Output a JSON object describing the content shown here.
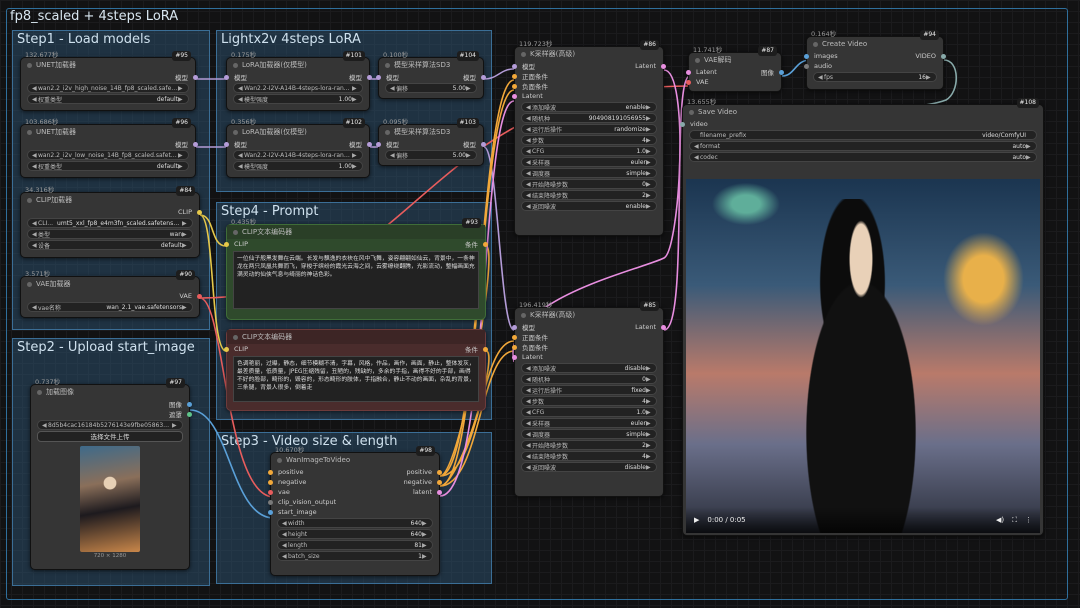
{
  "workflow_title": "fp8_scaled + 4steps LoRA",
  "groups": {
    "g1": "Step1 - Load models",
    "g2": "Lightx2v 4steps LoRA",
    "g3": "Step2 - Upload start_image",
    "g4": "Step4 - Prompt",
    "g5": "Step3 - Video size & length"
  },
  "unet1": {
    "time": "132.677秒",
    "badge": "#95",
    "title": "UNET加载器",
    "out": "模型",
    "model": "wan2.2_i2v_high_noise_14B_fp8_scaled.safet...",
    "dtype_label": "权重类型",
    "dtype": "default"
  },
  "unet2": {
    "time": "103.686秒",
    "badge": "#96",
    "title": "UNET加载器",
    "out": "模型",
    "model": "wan2.2_i2v_low_noise_14B_fp8_scaled.safete...",
    "dtype_label": "权重类型",
    "dtype": "default"
  },
  "clipl": {
    "time": "34.316秒",
    "badge": "#84",
    "title": "CLIP加载器",
    "out": "CLIP",
    "name_label": "CLI...",
    "name": "umt5_xxl_fp8_e4m3fn_scaled.safetensors",
    "type_label": "类型",
    "type": "wan",
    "device_label": "设备",
    "device": "default"
  },
  "vael": {
    "time": "3.571秒",
    "badge": "#90",
    "title": "VAE加载器",
    "out": "VAE",
    "name_label": "vae名称",
    "name": "wan_2.1_vae.safetensors"
  },
  "lora1": {
    "time": "0.175秒",
    "badge": "#101",
    "title": "LoRA加载器(仅模型)",
    "in": "模型",
    "out": "模型",
    "name": "Wan2.2-I2V-A14B-4steps-lora-ran...",
    "str_label": "模型强度",
    "str": "1.00"
  },
  "lora2": {
    "time": "0.356秒",
    "badge": "#102",
    "title": "LoRA加载器(仅模型)",
    "in": "模型",
    "out": "模型",
    "name": "Wan2.2-I2V-A14B-4steps-lora-rank...",
    "str_label": "模型强度",
    "str": "1.00"
  },
  "sd1": {
    "time": "0.100秒",
    "badge": "#104",
    "title": "模型采样算法SD3",
    "in": "模型",
    "out": "模型",
    "shift_label": "偏移",
    "shift": "5.00"
  },
  "sd2": {
    "time": "0.095秒",
    "badge": "#103",
    "title": "模型采样算法SD3",
    "in": "模型",
    "out": "模型",
    "shift_label": "偏移",
    "shift": "5.00"
  },
  "ks1": {
    "time": "119.723秒",
    "badge": "#86",
    "title": "K采样器(高级)",
    "inputs": [
      "模型",
      "正面条件",
      "负面条件",
      "Latent"
    ],
    "out": "Latent",
    "widgets": [
      [
        "添加噪波",
        "enable"
      ],
      [
        "随机种",
        "904908191056955"
      ],
      [
        "运行后操作",
        "randomize"
      ],
      [
        "步数",
        "4"
      ],
      [
        "CFG",
        "1.0"
      ],
      [
        "采样器",
        "euler"
      ],
      [
        "调度器",
        "simple"
      ],
      [
        "开始降噪步数",
        "0"
      ],
      [
        "结束降噪步数",
        "2"
      ],
      [
        "返回噪波",
        "enable"
      ]
    ]
  },
  "ks2": {
    "time": "196.419秒",
    "badge": "#85",
    "title": "K采样器(高级)",
    "inputs": [
      "模型",
      "正面条件",
      "负面条件",
      "Latent"
    ],
    "out": "Latent",
    "widgets": [
      [
        "添加噪波",
        "disable"
      ],
      [
        "随机种",
        "0"
      ],
      [
        "运行后操作",
        "fixed"
      ],
      [
        "步数",
        "4"
      ],
      [
        "CFG",
        "1.0"
      ],
      [
        "采样器",
        "euler"
      ],
      [
        "调度器",
        "simple"
      ],
      [
        "开始降噪步数",
        "2"
      ],
      [
        "结束降噪步数",
        "4"
      ],
      [
        "返回噪波",
        "disable"
      ]
    ]
  },
  "pos": {
    "time": "0.435秒",
    "badge": "#93",
    "title": "CLIP文本编码器",
    "in": "CLIP",
    "out": "条件",
    "text": "一位仙子般黑发舞在云端。长发与飘逸的衣袂在风中飞舞，姿容翩翩如仙云，背景中，一条神龙在两只凤凰共舞而飞，穿梭于缤纷的霞光云海之间，云雾缭绕翻腾，光影流动，整幅画面充满灵动的仙侠气息与绮丽的神话色彩。"
  },
  "neg": {
    "title": "CLIP文本编码器",
    "in": "CLIP",
    "out": "条件",
    "text": "色调艳丽，过曝，静态，细节模糊不清，字幕，风格，作品，画作，画面，静止，整体发灰，最差质量，低质量，JPEG压缩残留，丑陋的，残缺的，多余的手指，画得不好的手部，画得不好的脸部，畸形的，毁容的，形态畸形的肢体，手指融合，静止不动的画面，杂乱的背景，三条腿，背景人很多，倒着走"
  },
  "loadimg": {
    "time": "0.737秒",
    "badge": "#97",
    "title": "加载图像",
    "out1": "图像",
    "out2": "遮罩",
    "file": "8d5b4cac16184b5276143e9fbe0586393 ...",
    "btn": "选择文件上传",
    "size": "720 × 1280"
  },
  "wan": {
    "time": "10.670秒",
    "badge": "#98",
    "title": "WanImageToVideo",
    "inputs": [
      "positive",
      "negative",
      "vae",
      "clip_vision_output",
      "start_image"
    ],
    "outputs": [
      "positive",
      "negative",
      "latent"
    ],
    "widgets": [
      [
        "width",
        "640"
      ],
      [
        "height",
        "640"
      ],
      [
        "length",
        "81"
      ],
      [
        "batch_size",
        "1"
      ]
    ]
  },
  "vaed": {
    "time": "11.741秒",
    "badge": "#87",
    "title": "VAE解码",
    "in1": "Latent",
    "in2": "VAE",
    "out": "图像"
  },
  "cv": {
    "time": "0.164秒",
    "badge": "#94",
    "title": "Create Video",
    "in1": "images",
    "in2": "audio",
    "out": "VIDEO",
    "fps_label": "fps",
    "fps": "16"
  },
  "sv": {
    "time": "13.655秒",
    "badge": "#108",
    "title": "Save Video",
    "in": "video",
    "prefix_label": "filename_prefix",
    "prefix": "video/ComfyUI",
    "format_label": "format",
    "format": "auto",
    "codec_label": "codec",
    "codec": "auto",
    "time_display": "0:00 / 0:05"
  }
}
